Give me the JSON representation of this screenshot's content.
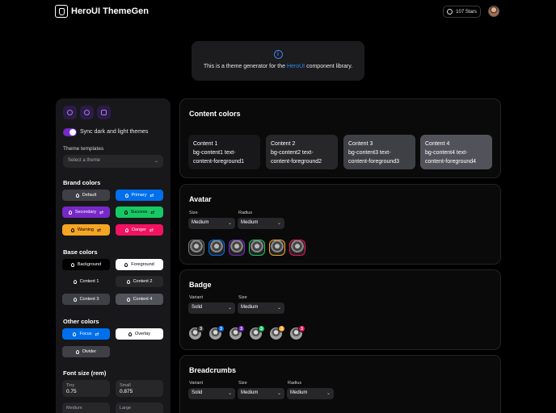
{
  "header": {
    "app_title": "HeroUI ThemeGen",
    "stars": "107 Stars"
  },
  "notice": {
    "text_before": "This is a theme generator for the ",
    "link": "HeroUI",
    "text_after": " component library."
  },
  "sidebar": {
    "sync_label": "Sync dark and light themes",
    "templates_label": "Theme templates",
    "templates_placeholder": "Select a theme",
    "brand_title": "Brand colors",
    "brand": {
      "default": "Default",
      "primary": "Primary",
      "secondary": "Secondary",
      "success": "Success",
      "warning": "Warning",
      "danger": "Danger"
    },
    "base_title": "Base colors",
    "base": {
      "background": "Background",
      "foreground": "Foreground",
      "content1": "Content 1",
      "content2": "Content 2",
      "content3": "Content 3",
      "content4": "Content 4"
    },
    "other_title": "Other colors",
    "other": {
      "focus": "Focus",
      "overlay": "Overlay",
      "divider": "Divider"
    },
    "font_title": "Font size (rem)",
    "fonts": [
      {
        "label": "Tiny",
        "value": "0.75"
      },
      {
        "label": "Small",
        "value": "0.875"
      },
      {
        "label": "Medium",
        "value": ""
      },
      {
        "label": "Large",
        "value": ""
      }
    ]
  },
  "content_colors": {
    "title": "Content colors",
    "cards": [
      {
        "line1": "Content 1",
        "line2": "bg-content1 text-",
        "line3": "content-foreground1"
      },
      {
        "line1": "Content 2",
        "line2": "bg-content2 text-",
        "line3": "content-foreground2"
      },
      {
        "line1": "Content 3",
        "line2": "bg-content3 text-",
        "line3": "content-foreground3"
      },
      {
        "line1": "Content 4",
        "line2": "bg-content4 text-",
        "line3": "content-foreground4"
      }
    ]
  },
  "avatar": {
    "title": "Avatar",
    "size_label": "Size",
    "size_value": "Medium",
    "radius_label": "Radius",
    "radius_value": "Medium"
  },
  "badge": {
    "title": "Badge",
    "variant_label": "Variant",
    "variant_value": "Solid",
    "size_label": "Size",
    "size_value": "Medium",
    "count": "3"
  },
  "breadcrumbs": {
    "title": "Breadcrumbs",
    "variant_label": "Variant",
    "variant_value": "Solid",
    "size_label": "Size",
    "size_value": "Medium",
    "radius_label": "Radius",
    "radius_value": "Medium"
  },
  "colors": {
    "default": "#3f3f46",
    "primary": "#006fee",
    "secondary": "#7828c8",
    "success": "#17c964",
    "warning": "#f5a524",
    "danger": "#f31260",
    "content1": "#18181b",
    "content2": "#27272a",
    "content3": "#3f3f46",
    "content4": "#52525b"
  }
}
